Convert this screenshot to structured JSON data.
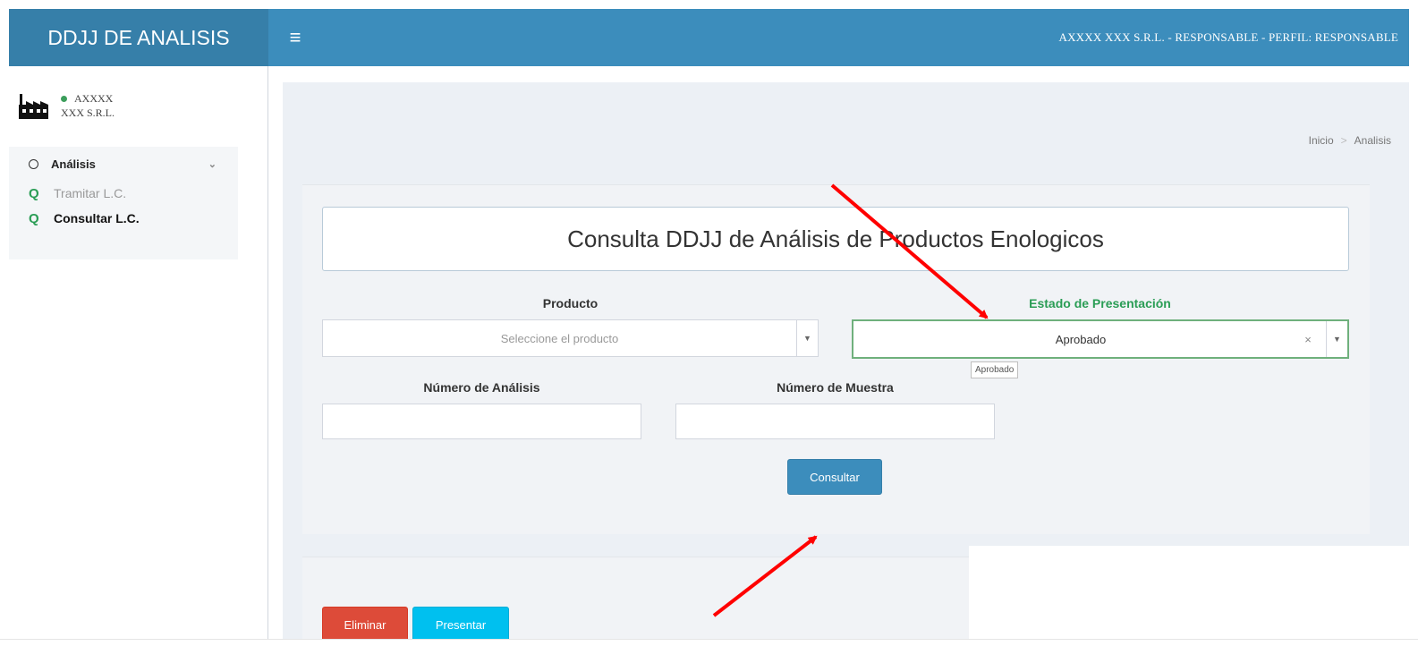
{
  "header": {
    "brand": "DDJJ DE ANALISIS",
    "menu_icon": "≡",
    "user_info": "AXXXX  XXX S.R.L.   - RESPONSABLE - PERFIL: RESPONSABLE"
  },
  "sidebar": {
    "company_line1": "AXXXX",
    "company_line2": "XXX S.R.L.",
    "menu": {
      "head": "Análisis",
      "items": [
        {
          "label": "Tramitar L.C."
        },
        {
          "label": "Consultar L.C."
        }
      ]
    }
  },
  "breadcrumb": {
    "home": "Inicio",
    "separator": ">",
    "current": "Analisis"
  },
  "form": {
    "title": "Consulta DDJJ de Análisis de Productos Enologicos",
    "producto_label": "Producto",
    "producto_placeholder": "Seleccione el producto",
    "estado_label": "Estado de Presentación",
    "estado_value": "Aprobado",
    "estado_tooltip": "Aprobado",
    "numero_analisis_label": "Número de Análisis",
    "numero_analisis_value": "",
    "numero_muestra_label": "Número de Muestra",
    "numero_muestra_value": "",
    "submit": "Consultar"
  },
  "actions": {
    "eliminar": "Eliminar",
    "presentar": "Presentar"
  },
  "colors": {
    "header": "#3c8dbc",
    "brand_bg": "#367fa9",
    "green": "#2a9d55",
    "danger": "#dd4b39",
    "info": "#00c0ef",
    "annotation_arrow": "#ff0000"
  }
}
